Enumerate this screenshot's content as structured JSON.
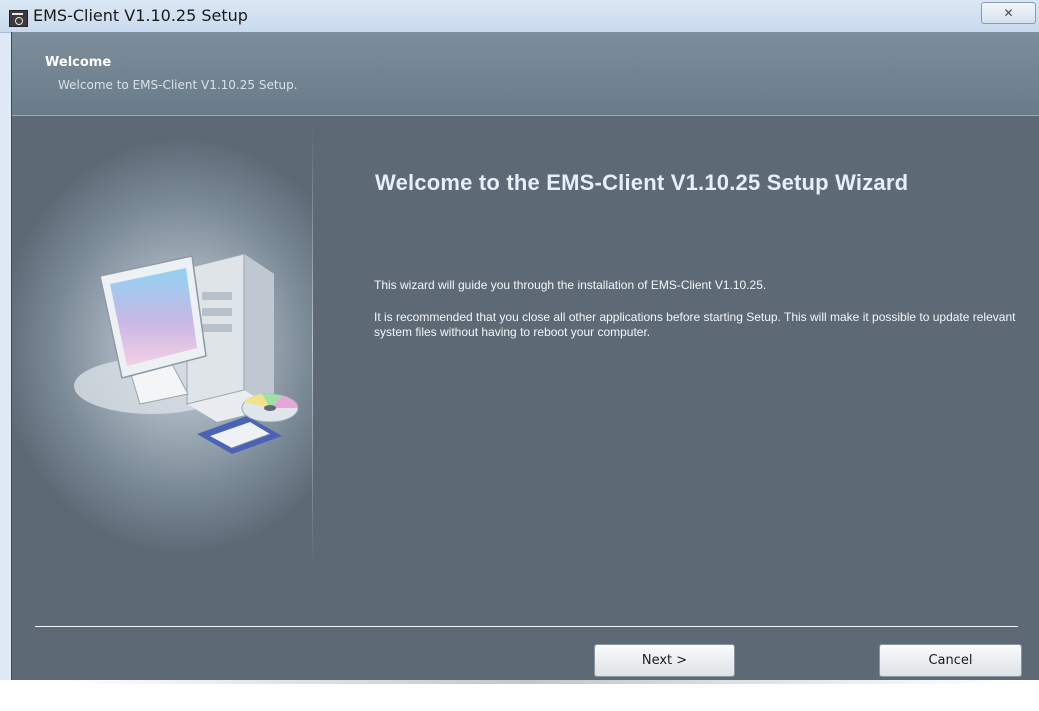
{
  "window": {
    "title": "EMS-Client V1.10.25 Setup",
    "close_label": "✕"
  },
  "header": {
    "title": "Welcome",
    "subtitle": "Welcome to EMS-Client V1.10.25 Setup."
  },
  "main": {
    "heading": "Welcome to the EMS-Client V1.10.25 Setup Wizard",
    "paragraph1": "This wizard will guide you through the installation of EMS-Client V1.10.25.",
    "paragraph2": "It is recommended that you close all other applications before starting Setup. This will make it possible to update relevant system files without having to reboot your computer."
  },
  "buttons": {
    "next_label": "Next >",
    "cancel_label": "Cancel"
  },
  "icons": {
    "app": "installer-icon",
    "illustration": "computer-with-cd-icon",
    "close": "close-icon"
  }
}
